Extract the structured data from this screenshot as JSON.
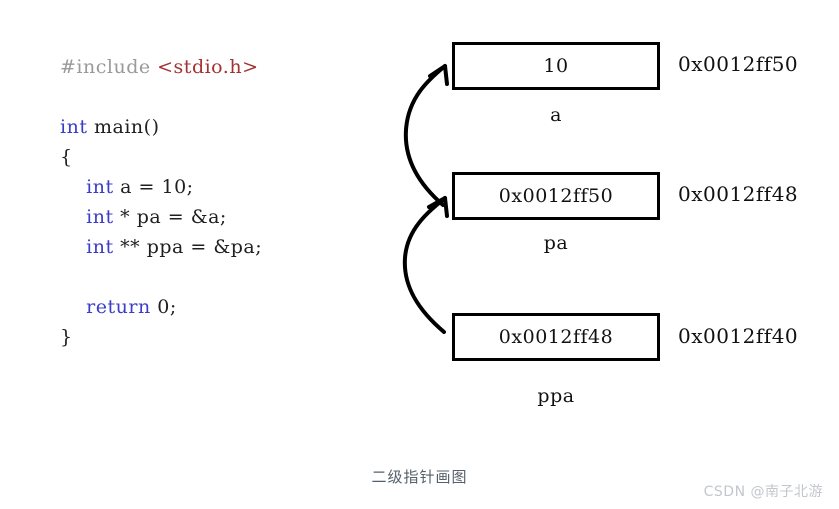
{
  "code": {
    "lines": [
      [
        {
          "t": "#include ",
          "c": "pre"
        },
        {
          "t": "<stdio.h>",
          "c": "inc"
        }
      ],
      [],
      [
        {
          "t": "int",
          "c": "kw"
        },
        {
          "t": " main()",
          "c": "plain"
        }
      ],
      [
        {
          "t": "{",
          "c": "plain"
        }
      ],
      [
        {
          "t": "    ",
          "c": "plain"
        },
        {
          "t": "int",
          "c": "kw"
        },
        {
          "t": " a = 10;",
          "c": "plain"
        }
      ],
      [
        {
          "t": "    ",
          "c": "plain"
        },
        {
          "t": "int",
          "c": "kw"
        },
        {
          "t": " * pa = &a;",
          "c": "plain"
        }
      ],
      [
        {
          "t": "    ",
          "c": "plain"
        },
        {
          "t": "int",
          "c": "kw"
        },
        {
          "t": " ** ppa = &pa;",
          "c": "plain"
        }
      ],
      [],
      [
        {
          "t": "    ",
          "c": "plain"
        },
        {
          "t": "return",
          "c": "kw"
        },
        {
          "t": " 0;",
          "c": "plain"
        }
      ],
      [
        {
          "t": "}",
          "c": "plain"
        }
      ]
    ]
  },
  "memory": {
    "boxes": [
      {
        "value": "10",
        "label": "a",
        "address": "0x0012ff50"
      },
      {
        "value": "0x0012ff50",
        "label": "pa",
        "address": "0x0012ff48"
      },
      {
        "value": "0x0012ff48",
        "label": "ppa",
        "address": "0x0012ff40"
      }
    ]
  },
  "arrows": [
    {
      "name": "pa-to-a",
      "from_label": "pa",
      "to_label": "a"
    },
    {
      "name": "ppa-to-pa",
      "from_label": "ppa",
      "to_label": "pa"
    }
  ],
  "caption": "二级指针画图",
  "watermark": "CSDN @南子北游",
  "colors": {
    "preprocessor": "#9a9a9a",
    "include_path": "#a33232",
    "keyword": "#3c3cc8",
    "plain": "#202020",
    "box_border": "#000000",
    "caption": "#55606b",
    "watermark": "#c3c7cc"
  }
}
